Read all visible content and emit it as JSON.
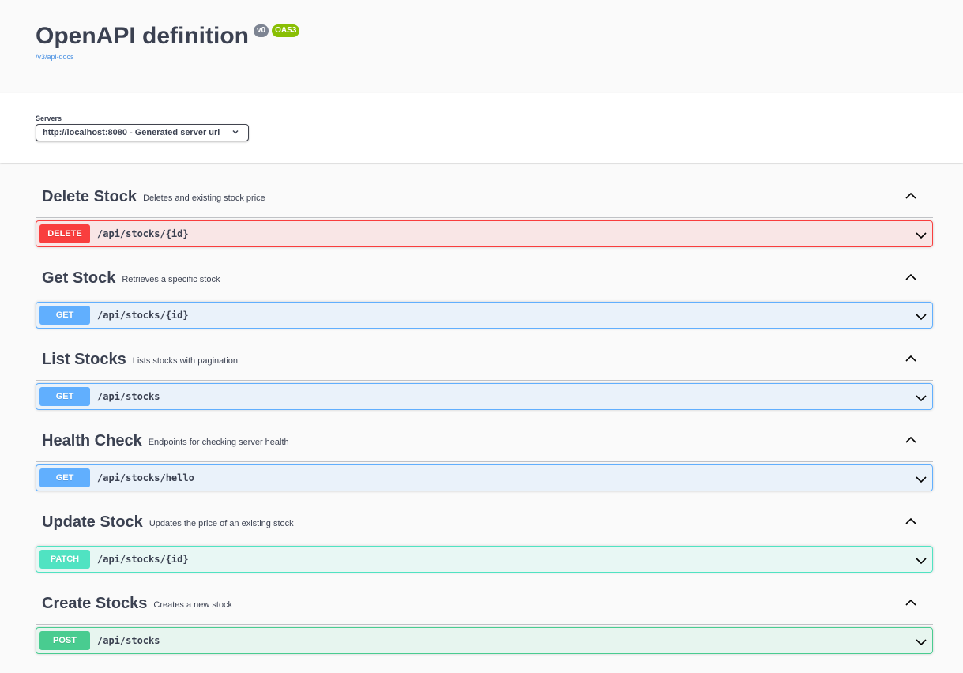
{
  "info": {
    "title": "OpenAPI definition",
    "version_badge": "v0",
    "oas_badge": "OAS3",
    "docs_link": "/v3/api-docs"
  },
  "servers": {
    "label": "Servers",
    "selected": "http://localhost:8080 - Generated server url"
  },
  "groups": [
    {
      "name": "Delete Stock",
      "description": "Deletes and existing stock price",
      "method": "DELETE",
      "path": "/api/stocks/{id}"
    },
    {
      "name": "Get Stock",
      "description": "Retrieves a specific stock",
      "method": "GET",
      "path": "/api/stocks/{id}"
    },
    {
      "name": "List Stocks",
      "description": "Lists stocks with pagination",
      "method": "GET",
      "path": "/api/stocks"
    },
    {
      "name": "Health Check",
      "description": "Endpoints for checking server health",
      "method": "GET",
      "path": "/api/stocks/hello"
    },
    {
      "name": "Update Stock",
      "description": "Updates the price of an existing stock",
      "method": "PATCH",
      "path": "/api/stocks/{id}"
    },
    {
      "name": "Create Stocks",
      "description": "Creates a new stock",
      "method": "POST",
      "path": "/api/stocks"
    }
  ],
  "colors": {
    "delete": "#f93e3e",
    "get": "#61affe",
    "patch": "#50e3c2",
    "post": "#49cc90"
  }
}
